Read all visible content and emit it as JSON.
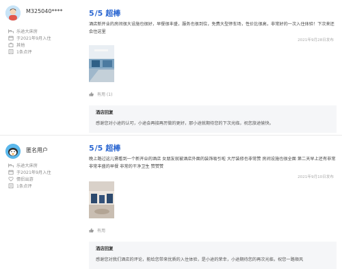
{
  "reviews": [
    {
      "user": "M325040****",
      "meta": [
        {
          "icon": "bed-icon",
          "text": "乐途大床房"
        },
        {
          "icon": "calendar-icon",
          "text": "于2021年9月入住"
        },
        {
          "icon": "trip-type-icon",
          "text": "其他"
        },
        {
          "icon": "review-count-icon",
          "text": "1条点评"
        }
      ],
      "score": "5",
      "score_suffix": "/5",
      "score_word": "超棒",
      "text": "酒店新开业的房间很大设施也很好，早餐很丰盛，服务也很到位，免费大型停车场，性价比很高，非常好的一次入住体验！下次来还会住这里",
      "date": "2021年9月28日发布",
      "helpful": "有用 (1)",
      "reply_title": "酒店回复",
      "reply_text": "感谢您对小途的认可，小途会再接再厉做的更好，那小途就期待您的下次光临，祝您旅途愉快。"
    },
    {
      "user": "匿名用户",
      "meta": [
        {
          "icon": "bed-icon",
          "text": "乐途大床房"
        },
        {
          "icon": "calendar-icon",
          "text": "于2021年9月入住"
        },
        {
          "icon": "trip-type-icon",
          "text": "情侣出游"
        },
        {
          "icon": "review-count-icon",
          "text": "1条点评"
        }
      ],
      "score": "5",
      "score_suffix": "/5",
      "score_word": "超棒",
      "text": "晚上路过这儿需看到一个新开业的酒店 女朋友就被酒店外面的装饰吸引啦 大厅装修也非常赞 房间设施也很全面 第二天早上还有非常非常丰盛的早餐 非常的干净卫生 赞赞赞",
      "date": "2021年9月10日发布",
      "helpful": "有用",
      "reply_title": "酒店回复",
      "reply_text": "感谢您对我们酒店的评论，能给您带来优质的入住体验，是小途的荣幸，小途期待您的再次光临，祝您一路顺风"
    }
  ]
}
